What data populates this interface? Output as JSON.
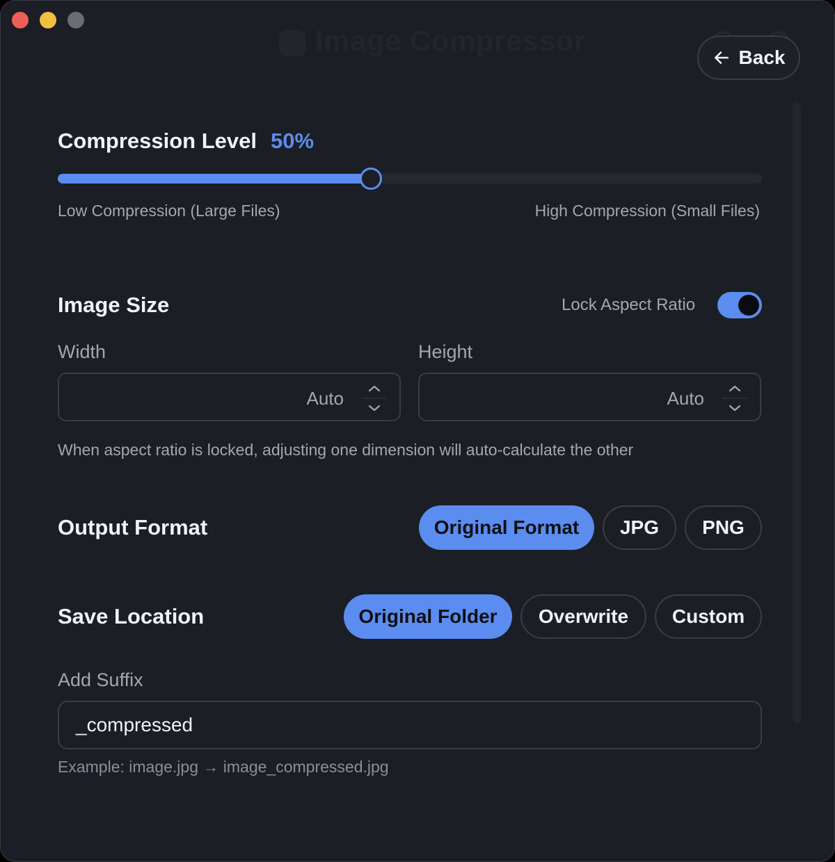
{
  "window": {
    "title": "Image Compressor"
  },
  "header": {
    "back_label": "Back"
  },
  "compression": {
    "title": "Compression Level",
    "value_label": "50%",
    "value": 0.5,
    "low_label": "Low Compression (Large Files)",
    "high_label": "High Compression (Small Files)"
  },
  "image_size": {
    "title": "Image Size",
    "lock_label": "Lock Aspect Ratio",
    "lock_on": true,
    "width_label": "Width",
    "width_value": "Auto",
    "height_label": "Height",
    "height_value": "Auto",
    "hint": "When aspect ratio is locked, adjusting one dimension will auto-calculate the other"
  },
  "output_format": {
    "title": "Output Format",
    "options": [
      "Original Format",
      "JPG",
      "PNG"
    ],
    "selected": "Original Format"
  },
  "save_location": {
    "title": "Save Location",
    "options": [
      "Original Folder",
      "Overwrite",
      "Custom"
    ],
    "selected": "Original Folder"
  },
  "suffix": {
    "label": "Add Suffix",
    "value": "_compressed",
    "example": "Example: image.jpg → image_compressed.jpg"
  },
  "colors": {
    "accent": "#5b8cf0",
    "background": "#1c1e26"
  }
}
